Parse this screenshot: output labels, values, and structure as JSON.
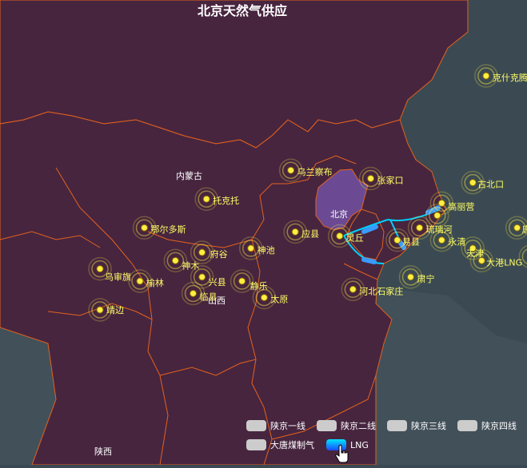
{
  "title": "北京天然气供应",
  "provinces": [
    "内蒙古",
    "北京",
    "山西",
    "陕西"
  ],
  "cities": [
    {
      "name": "克什克腾旗",
      "lon": 117.5,
      "lat": 43.3
    },
    {
      "name": "乌兰察布",
      "lon": 113.1,
      "lat": 41.0
    },
    {
      "name": "张家口",
      "lon": 114.9,
      "lat": 40.8
    },
    {
      "name": "古北口",
      "lon": 117.2,
      "lat": 40.7
    },
    {
      "name": "高丽营",
      "lon": 116.5,
      "lat": 40.2
    },
    {
      "name": "托克托",
      "lon": 111.2,
      "lat": 40.3
    },
    {
      "name": "北京",
      "lon": 116.4,
      "lat": 39.9
    },
    {
      "name": "唐山",
      "lon": 118.2,
      "lat": 39.6
    },
    {
      "name": "鄂尔多斯",
      "lon": 109.8,
      "lat": 39.6
    },
    {
      "name": "应县",
      "lon": 113.2,
      "lat": 39.5
    },
    {
      "name": "灵丘",
      "lon": 114.2,
      "lat": 39.4
    },
    {
      "name": "易县",
      "lon": 115.5,
      "lat": 39.3
    },
    {
      "name": "琉璃河",
      "lon": 116.0,
      "lat": 39.6
    },
    {
      "name": "永清",
      "lon": 116.5,
      "lat": 39.3
    },
    {
      "name": "府谷",
      "lon": 111.1,
      "lat": 39.0
    },
    {
      "name": "神池",
      "lon": 112.2,
      "lat": 39.1
    },
    {
      "name": "神木",
      "lon": 110.5,
      "lat": 38.8
    },
    {
      "name": "曹妃甸LNG",
      "lon": 118.5,
      "lat": 38.9
    },
    {
      "name": "天津",
      "lon": 117.2,
      "lat": 39.1
    },
    {
      "name": "大港LNG",
      "lon": 117.4,
      "lat": 38.8
    },
    {
      "name": "乌审旗",
      "lon": 108.8,
      "lat": 38.6
    },
    {
      "name": "兴县",
      "lon": 111.1,
      "lat": 38.4
    },
    {
      "name": "静乐",
      "lon": 112.0,
      "lat": 38.3
    },
    {
      "name": "榆林",
      "lon": 109.7,
      "lat": 38.3
    },
    {
      "name": "临县",
      "lon": 110.9,
      "lat": 38.0
    },
    {
      "name": "太原",
      "lon": 112.5,
      "lat": 37.9
    },
    {
      "name": "肃宁",
      "lon": 115.8,
      "lat": 38.4
    },
    {
      "name": "河北石家庄",
      "lon": 114.5,
      "lat": 38.1
    },
    {
      "name": "靖边",
      "lon": 108.8,
      "lat": 37.6
    }
  ],
  "legend": [
    {
      "name": "陕京一线",
      "active": false
    },
    {
      "name": "陕京二线",
      "active": false
    },
    {
      "name": "陕京三线",
      "active": false
    },
    {
      "name": "陕京四线",
      "active": false
    },
    {
      "name": "大唐煤制气",
      "active": false
    },
    {
      "name": "LNG",
      "active": true
    }
  ],
  "colors": {
    "background": "#3b4a52",
    "region": "#47253f",
    "beijing": "#6b4a93",
    "border": "#e3621d",
    "label": "#ffff66",
    "marker": "#ffee44",
    "flow": "#00d0ff",
    "legend_off": "#cccccc"
  }
}
